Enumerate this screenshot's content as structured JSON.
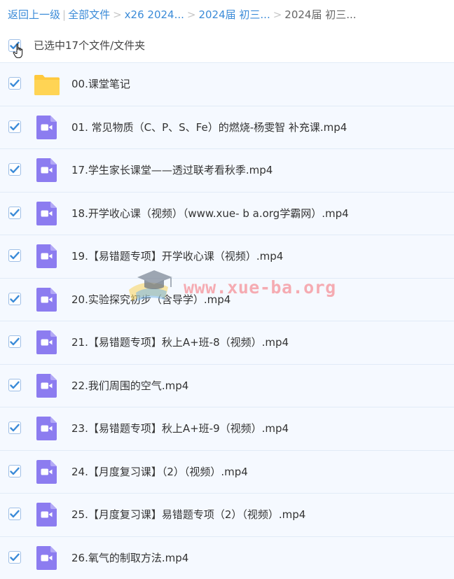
{
  "breadcrumb": {
    "back": "返回上一级",
    "root": "全部文件",
    "level1": "x26 2024...",
    "level2": "2024届 初三...",
    "current": "2024届 初三..."
  },
  "selection": {
    "text": "已选中17个文件/文件夹"
  },
  "files": [
    {
      "name": "00.课堂笔记",
      "type": "folder"
    },
    {
      "name": "01. 常见物质（C、P、S、Fe）的燃烧-杨雯智 补充课.mp4",
      "type": "video"
    },
    {
      "name": "17.学生家长课堂——透过联考看秋季.mp4",
      "type": "video"
    },
    {
      "name": "18.开学收心课（视频）（www.xue- b a.org学霸网）.mp4",
      "type": "video"
    },
    {
      "name": "19.【易错题专项】开学收心课（视频）.mp4",
      "type": "video"
    },
    {
      "name": "20.实验探究初步（含导学）.mp4",
      "type": "video"
    },
    {
      "name": "21.【易错题专项】秋上A+班-8（视频）.mp4",
      "type": "video"
    },
    {
      "name": "22.我们周围的空气.mp4",
      "type": "video"
    },
    {
      "name": "23.【易错题专项】秋上A+班-9（视频）.mp4",
      "type": "video"
    },
    {
      "name": "24.【月度复习课】（2）（视频）.mp4",
      "type": "video"
    },
    {
      "name": "25.【月度复习课】易错题专项（2）（视频）.mp4",
      "type": "video"
    },
    {
      "name": "26.氧气的制取方法.mp4",
      "type": "video"
    }
  ],
  "watermark": {
    "text": "www.xue-ba.org"
  },
  "colors": {
    "link": "#3b8bd8",
    "check": "#3b8bd8",
    "folder": "#ffc93d",
    "video": "#8c7cf0",
    "row_bg": "#f5f9ff"
  }
}
